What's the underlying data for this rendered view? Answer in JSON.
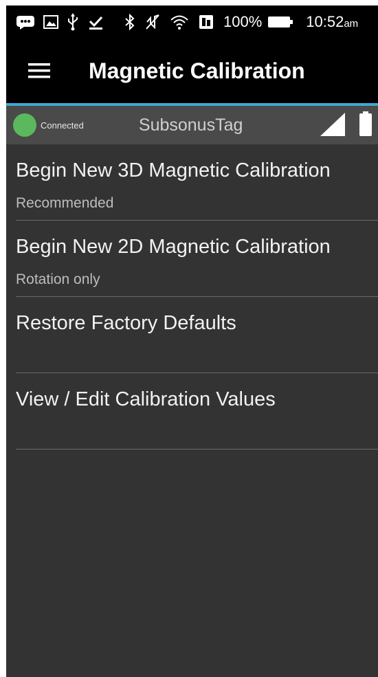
{
  "status_bar": {
    "icons": [
      "message-icon",
      "gallery-icon",
      "usb-icon",
      "download-done-icon",
      "bluetooth-icon",
      "mute-icon",
      "wifi-icon",
      "nfc-icon"
    ],
    "battery_percent": "100%",
    "time": "10:52",
    "time_suffix": "am"
  },
  "toolbar": {
    "title": "Magnetic Calibration"
  },
  "connection": {
    "status_label": "Connected",
    "status_color": "#5cb85c",
    "device_name": "SubsonusTag"
  },
  "menu": {
    "items": [
      {
        "title": "Begin New 3D Magnetic Calibration",
        "subtitle": "Recommended"
      },
      {
        "title": "Begin New 2D Magnetic Calibration",
        "subtitle": "Rotation only"
      },
      {
        "title": "Restore Factory Defaults",
        "subtitle": ""
      },
      {
        "title": "View / Edit Calibration Values",
        "subtitle": ""
      }
    ]
  },
  "colors": {
    "accent": "#3fa9d4",
    "background": "#333333",
    "toolbar": "#000000"
  }
}
